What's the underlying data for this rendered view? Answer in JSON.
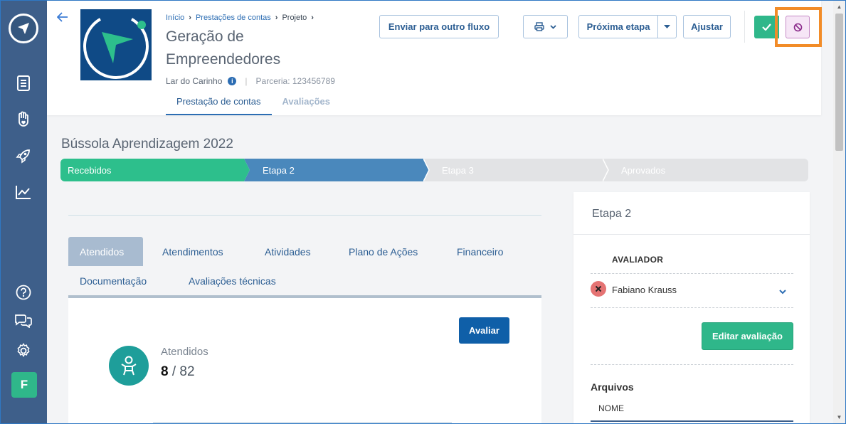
{
  "header": {
    "breadcrumb": [
      "Início",
      "Prestações de contas",
      "Projeto"
    ],
    "title": "Geração de Empreendedores",
    "organization": "Lar do Carinho",
    "parceria": "Parceria: 123456789",
    "tabs": [
      {
        "label": "Prestação de contas",
        "active": true
      },
      {
        "label": "Avaliações",
        "active": false
      }
    ],
    "buttons": {
      "fluxo": "Enviar para outro fluxo",
      "proxima": "Próxima etapa",
      "ajustar": "Ajustar"
    }
  },
  "main": {
    "title": "Bússola Aprendizagem 2022",
    "steps": [
      {
        "label": "Recebidos",
        "state": "done"
      },
      {
        "label": "Etapa 2",
        "state": "current"
      },
      {
        "label": "Etapa 3",
        "state": "pending"
      },
      {
        "label": "Aprovados",
        "state": "pending"
      }
    ],
    "tabs": [
      {
        "label": "Atendidos",
        "active": true
      },
      {
        "label": "Atendimentos",
        "active": false
      },
      {
        "label": "Atividades",
        "active": false
      },
      {
        "label": "Plano de Ações",
        "active": false
      },
      {
        "label": "Financeiro",
        "active": false
      },
      {
        "label": "Documentação",
        "active": false
      },
      {
        "label": "Avaliações técnicas",
        "active": false
      }
    ],
    "panel": {
      "avaliar": "Avaliar",
      "label": "Atendidos",
      "count": "8",
      "total": "82"
    }
  },
  "sidebar": {
    "items": [
      "logo-icon",
      "document-icon",
      "hand-heart-icon",
      "rocket-icon",
      "chart-icon",
      "help-icon",
      "chat-icon",
      "gear-icon"
    ],
    "avatar": "F"
  },
  "right": {
    "title": "Etapa 2",
    "avaliador_heading": "AVALIADOR",
    "avaliador_name": "Fabiano Krauss",
    "editar": "Editar avaliação",
    "arquivos": "Arquivos",
    "nome_col": "NOME"
  },
  "colors": {
    "sidebar": "#3e5f8a",
    "green": "#2fb78a",
    "blue": "#0f5fa8",
    "highlight": "#f28c28"
  }
}
